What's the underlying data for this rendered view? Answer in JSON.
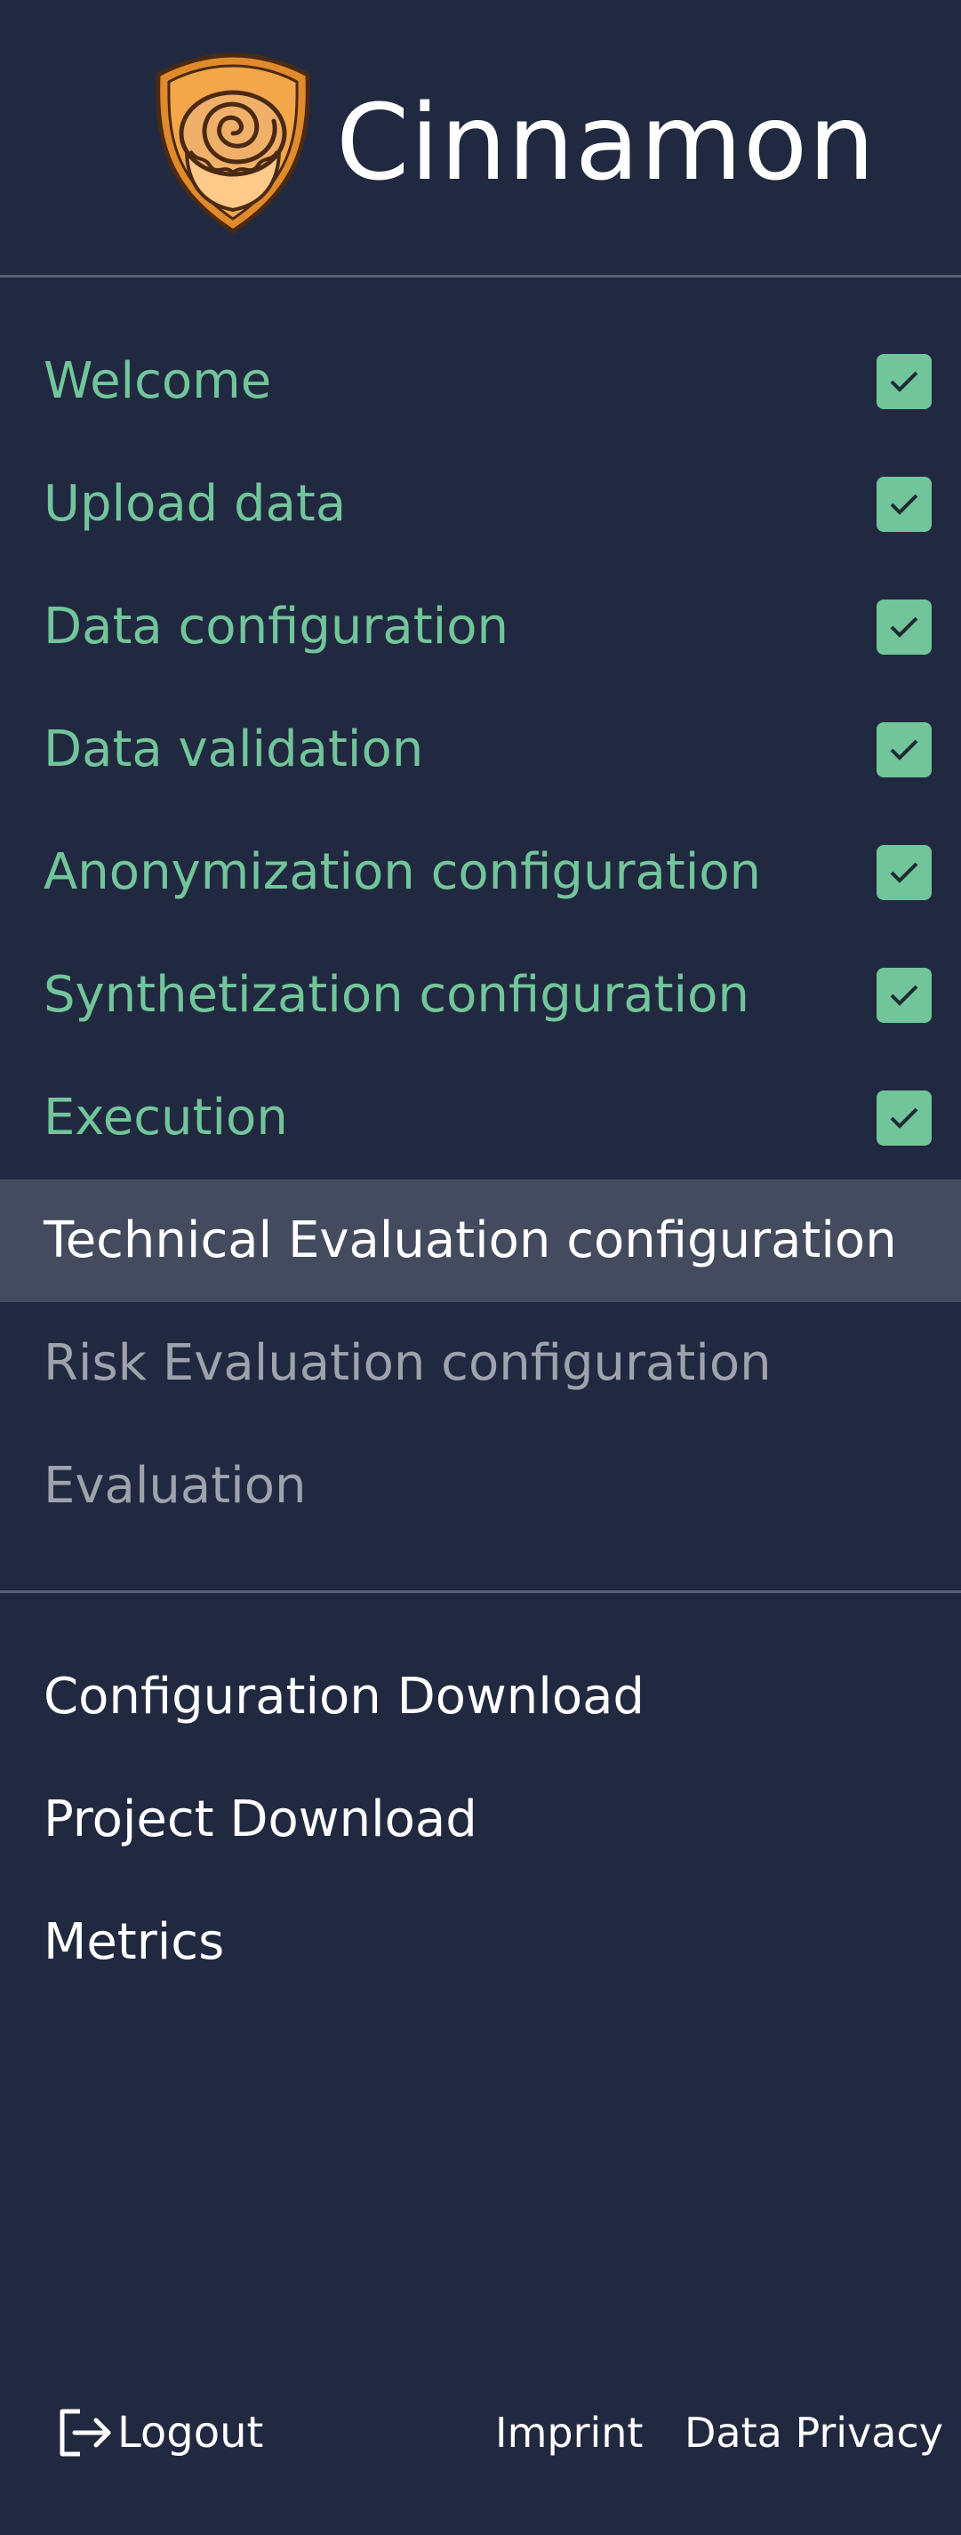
{
  "app": {
    "title": "Cinnamon",
    "logo_icon": "cinnamon-roll-shield-icon"
  },
  "colors": {
    "background": "#212940",
    "completed": "#72c59a",
    "current_bg": "#454b5e",
    "pending": "#9ea2ad",
    "logo_orange": "#e08a2c"
  },
  "steps": [
    {
      "label": "Welcome",
      "state": "completed"
    },
    {
      "label": "Upload data",
      "state": "completed"
    },
    {
      "label": "Data configuration",
      "state": "completed"
    },
    {
      "label": "Data validation",
      "state": "completed"
    },
    {
      "label": "Anonymization configuration",
      "state": "completed"
    },
    {
      "label": "Synthetization configuration",
      "state": "completed"
    },
    {
      "label": "Execution",
      "state": "completed"
    },
    {
      "label": "Technical Evaluation configuration",
      "state": "current"
    },
    {
      "label": "Risk Evaluation configuration",
      "state": "pending"
    },
    {
      "label": "Evaluation",
      "state": "pending"
    }
  ],
  "links": [
    {
      "label": "Configuration Download"
    },
    {
      "label": "Project Download"
    },
    {
      "label": "Metrics"
    }
  ],
  "footer": {
    "logout_label": "Logout",
    "logout_icon": "logout-icon",
    "imprint_label": "Imprint",
    "privacy_label": "Data Privacy"
  }
}
